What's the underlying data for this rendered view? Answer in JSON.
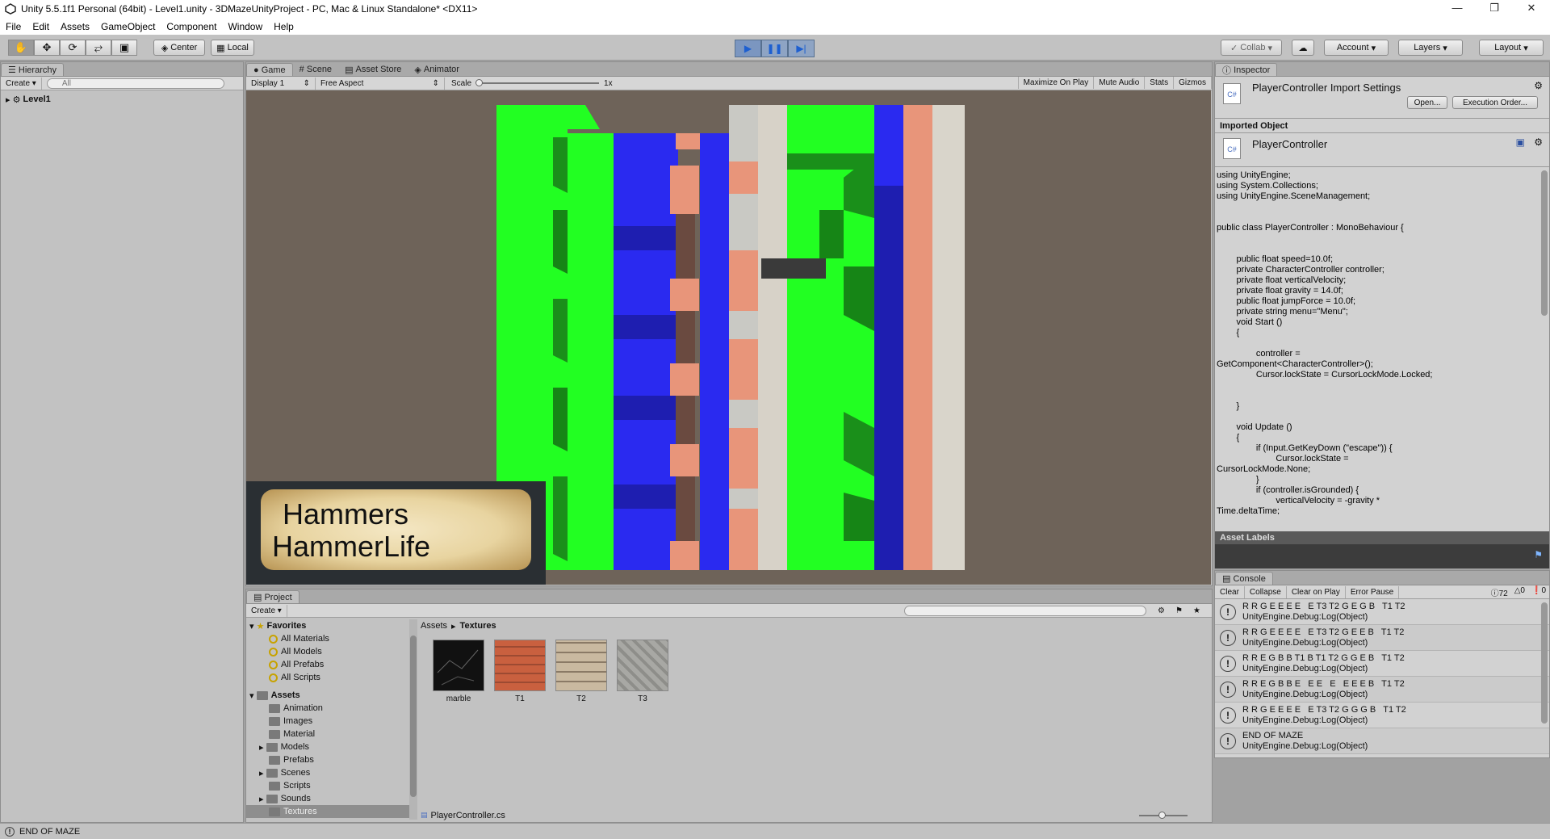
{
  "window": {
    "title": "Unity 5.5.1f1 Personal (64bit) - Level1.unity - 3DMazeUnityProject - PC, Mac & Linux Standalone* <DX11>"
  },
  "menu": [
    "File",
    "Edit",
    "Assets",
    "GameObject",
    "Component",
    "Window",
    "Help"
  ],
  "toolbar": {
    "pivot_label": "Center",
    "space_label": "Local",
    "collab_label": "Collab",
    "account_label": "Account",
    "layers_label": "Layers",
    "layout_label": "Layout"
  },
  "hierarchy": {
    "tab": "Hierarchy",
    "create": "Create",
    "search_placeholder": "All",
    "scene": "Level1"
  },
  "game": {
    "tabs": [
      "Game",
      "Scene",
      "Asset Store",
      "Animator"
    ],
    "display": "Display 1",
    "aspect": "Free Aspect",
    "scale_label": "Scale",
    "scale_value": "1x",
    "buttons": [
      "Maximize On Play",
      "Mute Audio",
      "Stats",
      "Gizmos"
    ],
    "badge_line1": "Hammers",
    "badge_line2": "HammerLife"
  },
  "inspector": {
    "tab": "Inspector",
    "header": "PlayerController Import Settings",
    "open_button": "Open...",
    "exec_order_button": "Execution Order...",
    "imported_object_label": "Imported Object",
    "object_name": "PlayerController",
    "code": "using UnityEngine;\nusing System.Collections;\nusing UnityEngine.SceneManagement;\n\n\npublic class PlayerController : MonoBehaviour {\n\n\n\t\tpublic float speed=10.0f;\n\t\tprivate CharacterController controller;\n\t\tprivate float verticalVelocity;\n\t\tprivate float gravity = 14.0f;\n\t\tpublic float jumpForce = 10.0f;\n\t\tprivate string menu=\"Menu\";\n\t\tvoid Start ()\n\t\t{\n\n\t\t\t\tcontroller =\nGetComponent<CharacterController>();\n\t\t\t\tCursor.lockState = CursorLockMode.Locked;\n\n\n\t\t}\n\n\t\tvoid Update ()\n\t\t{\n\t\t\t\tif (Input.GetKeyDown (\"escape\")) {\n\t\t\t\t\t\tCursor.lockState =\nCursorLockMode.None;\n\t\t\t\t}\n\t\t\t\tif (controller.isGrounded) {\n\t\t\t\t\t\tverticalVelocity = -gravity *\nTime.deltaTime;",
    "asset_labels": "Asset Labels"
  },
  "console": {
    "tab": "Console",
    "buttons": [
      "Clear",
      "Collapse",
      "Clear on Play",
      "Error Pause"
    ],
    "counts": {
      "logs": "72",
      "warnings": "0",
      "errors": "0"
    },
    "entries": [
      {
        "line1": "R R G E E E E   E T3 T2 G E G B   T1 T2",
        "line2": "UnityEngine.Debug:Log(Object)"
      },
      {
        "line1": "R R G E E E E   E T3 T2 G E E B   T1 T2",
        "line2": "UnityEngine.Debug:Log(Object)"
      },
      {
        "line1": "R R E G B B T1 B T1 T2 G G E B   T1 T2",
        "line2": "UnityEngine.Debug:Log(Object)"
      },
      {
        "line1": "R R E G B B E   E E   E   E E E B   T1 T2",
        "line2": "UnityEngine.Debug:Log(Object)"
      },
      {
        "line1": "R R G E E E E   E T3 T2 G G G B   T1 T2",
        "line2": "UnityEngine.Debug:Log(Object)"
      },
      {
        "line1": "END OF MAZE",
        "line2": "UnityEngine.Debug:Log(Object)"
      }
    ]
  },
  "project": {
    "tab": "Project",
    "create": "Create",
    "favorites_label": "Favorites",
    "favorites": [
      "All Materials",
      "All Models",
      "All Prefabs",
      "All Scripts"
    ],
    "assets_label": "Assets",
    "folders": [
      "Animation",
      "Images",
      "Material",
      "Models",
      "Prefabs",
      "Scenes",
      "Scripts",
      "Sounds",
      "Textures"
    ],
    "breadcrumb_root": "Assets",
    "breadcrumb_current": "Textures",
    "files": [
      "marble",
      "T1",
      "T2",
      "T3"
    ],
    "selected_file": "PlayerController.cs"
  },
  "status": {
    "message": "END OF MAZE"
  },
  "colors": {
    "maze_green": "#22ff22",
    "maze_blue": "#2a2af0",
    "maze_brick": "#e8957a",
    "maze_stone": "#c9c9c4"
  }
}
